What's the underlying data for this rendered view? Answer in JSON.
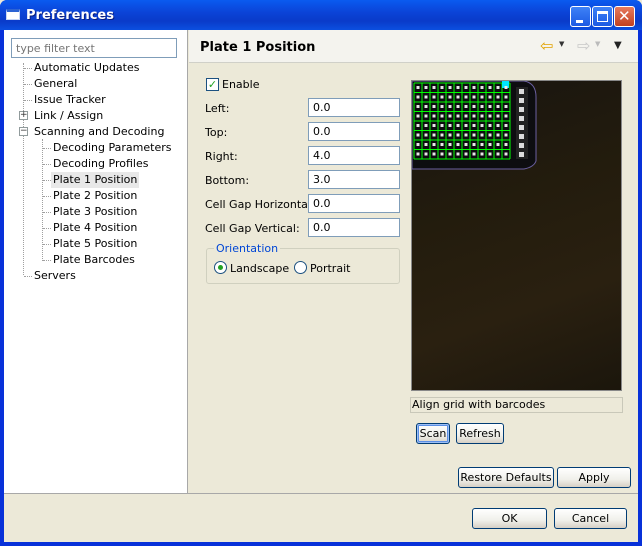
{
  "window": {
    "title": "Preferences"
  },
  "filter": {
    "placeholder": "type filter text"
  },
  "tree": {
    "items": [
      {
        "label": "Automatic Updates"
      },
      {
        "label": "General"
      },
      {
        "label": "Issue Tracker"
      },
      {
        "label": "Link / Assign",
        "expander": "+"
      },
      {
        "label": "Scanning and Decoding",
        "expander": "−"
      },
      {
        "label": "Decoding Parameters"
      },
      {
        "label": "Decoding Profiles"
      },
      {
        "label": "Plate 1 Position",
        "selected": true
      },
      {
        "label": "Plate 2 Position"
      },
      {
        "label": "Plate 3 Position"
      },
      {
        "label": "Plate 4 Position"
      },
      {
        "label": "Plate 5 Position"
      },
      {
        "label": "Plate Barcodes"
      },
      {
        "label": "Servers"
      }
    ]
  },
  "page": {
    "title": "Plate 1 Position",
    "enable_label": "Enable",
    "enable_checked": true,
    "fields": {
      "left": {
        "label": "Left:",
        "value": "0.0"
      },
      "top": {
        "label": "Top:",
        "value": "0.0"
      },
      "right": {
        "label": "Right:",
        "value": "4.0"
      },
      "bottom": {
        "label": "Bottom:",
        "value": "3.0"
      },
      "gap_h": {
        "label": "Cell Gap Horizontal:",
        "value": "0.0"
      },
      "gap_v": {
        "label": "Cell Gap Vertical:",
        "value": "0.0"
      }
    },
    "orientation": {
      "legend": "Orientation",
      "landscape": "Landscape",
      "portrait": "Portrait",
      "selected": "Landscape"
    },
    "status": "Align grid with barcodes",
    "scan_label": "Scan",
    "refresh_label": "Refresh",
    "restore_label": "Restore Defaults",
    "apply_label": "Apply"
  },
  "dialog": {
    "ok_label": "OK",
    "cancel_label": "Cancel"
  },
  "icons": {
    "back": "arrow-left-icon",
    "forward": "arrow-right-icon",
    "menu": "view-menu-icon"
  },
  "colors": {
    "titlebar": "#0a3bc9",
    "grid": "#00ff00",
    "check": "#21a121"
  }
}
